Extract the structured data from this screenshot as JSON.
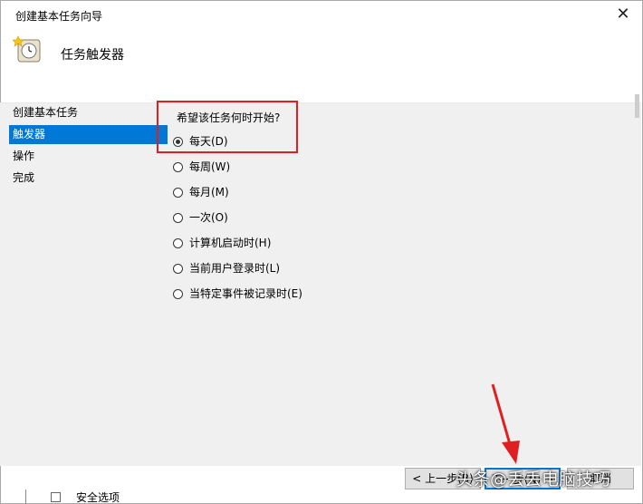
{
  "window": {
    "title": "创建基本任务向导",
    "close_glyph": "✕"
  },
  "header": {
    "title": "任务触发器",
    "icon": "clock-icon"
  },
  "nav": {
    "items": [
      {
        "label": "创建基本任务",
        "active": false
      },
      {
        "label": "触发器",
        "active": true
      },
      {
        "label": "操作",
        "active": false
      },
      {
        "label": "完成",
        "active": false
      }
    ]
  },
  "main": {
    "prompt": "希望该任务何时开始?",
    "options": [
      {
        "label": "每天(D)",
        "selected": true
      },
      {
        "label": "每周(W)",
        "selected": false
      },
      {
        "label": "每月(M)",
        "selected": false
      },
      {
        "label": "一次(O)",
        "selected": false
      },
      {
        "label": "计算机启动时(H)",
        "selected": false
      },
      {
        "label": "当前用户登录时(L)",
        "selected": false
      },
      {
        "label": "当特定事件被记录时(E)",
        "selected": false
      }
    ]
  },
  "buttons": {
    "back": "< 上一步(B)",
    "next": "下一步(N) >",
    "cancel": "取消"
  },
  "background": {
    "partial_text": "安全选项"
  },
  "watermark": {
    "text": "头条@丢丢电脑技巧"
  },
  "colors": {
    "selection": "#0078d7",
    "highlight_box": "#e02020",
    "arrow": "#e02020"
  }
}
